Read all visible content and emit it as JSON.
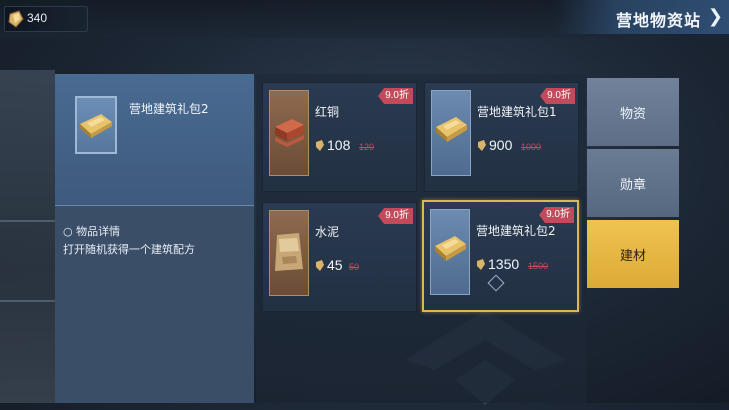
{
  "header": {
    "currency_amount": "340",
    "title": "营地物资站",
    "back_icon": "chevron-right-icon"
  },
  "detail": {
    "item_name": "营地建筑礼包2",
    "section_label": "○ 物品详情",
    "description": "打开随机获得一个建筑配方"
  },
  "items": [
    {
      "name": "红铜",
      "discount": "9.0折",
      "price": "108",
      "original_price": "120",
      "icon": "copper-ingot-icon"
    },
    {
      "name": "营地建筑礼包1",
      "discount": "9.0折",
      "price": "900",
      "original_price": "1000",
      "icon": "building-pack-icon"
    },
    {
      "name": "水泥",
      "discount": "9.0折",
      "price": "45",
      "original_price": "50",
      "icon": "cement-bag-icon"
    },
    {
      "name": "营地建筑礼包2",
      "discount": "9.0折",
      "price": "1350",
      "original_price": "1500",
      "icon": "building-pack-icon",
      "selected": true
    }
  ],
  "tabs": [
    {
      "label": "物资",
      "active": false
    },
    {
      "label": "勋章",
      "active": false
    },
    {
      "label": "建材",
      "active": true
    }
  ],
  "colors": {
    "accent_gold": "#e1b552",
    "discount_red": "#c34a5a",
    "active_tab": "#f0c350"
  }
}
